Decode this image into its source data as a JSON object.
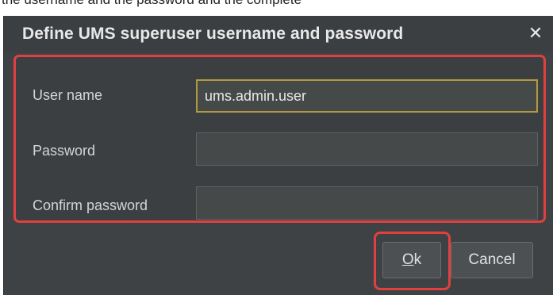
{
  "background_text": "the username and the password and the complete",
  "dialog": {
    "title": "Define UMS superuser username and password",
    "close_glyph": "✕",
    "close_icon": "close-icon"
  },
  "form": {
    "username_label": "User name",
    "username_value": "ums.admin.user",
    "password_label": "Password",
    "password_value": "",
    "confirm_label": "Confirm password",
    "confirm_value": ""
  },
  "buttons": {
    "ok_mnemonic": "O",
    "ok_rest": "k",
    "cancel_label": "Cancel"
  },
  "colors": {
    "dialog_background": "#3c3f41",
    "highlight": "#e0403f",
    "focus_border": "#b49a3e"
  }
}
